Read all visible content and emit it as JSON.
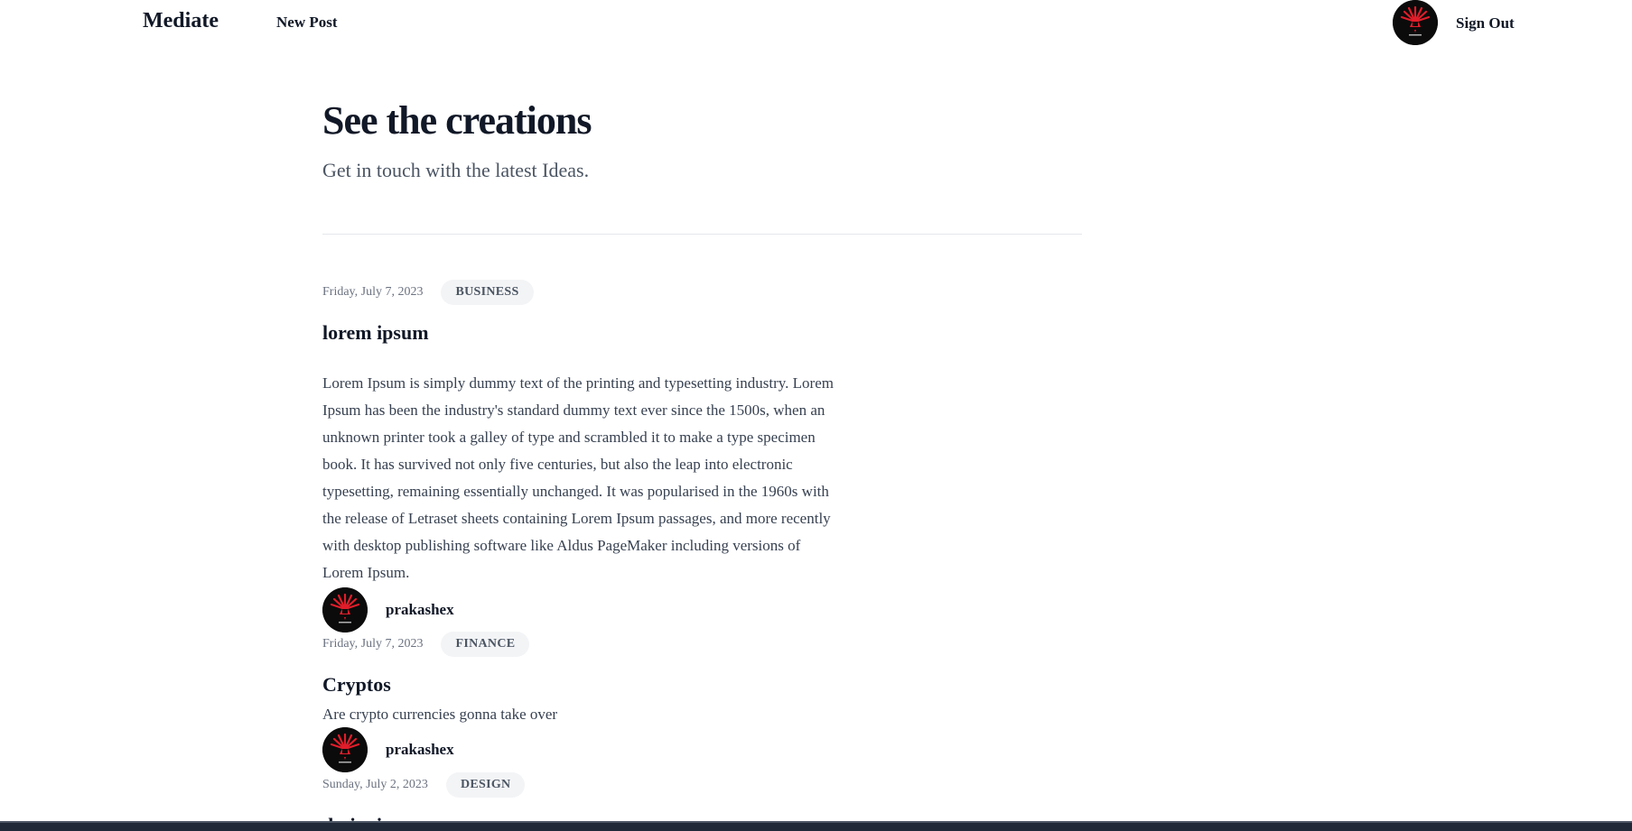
{
  "nav": {
    "brand": "Mediate",
    "new_post": "New Post",
    "sign_out": "Sign Out"
  },
  "hero": {
    "title": "See the creations",
    "subtitle": "Get in touch with the latest Ideas."
  },
  "posts": [
    {
      "date": "Friday, July 7, 2023",
      "category": "BUSINESS",
      "title": "lorem ipsum",
      "body": "Lorem Ipsum is simply dummy text of the printing and typesetting industry. Lorem Ipsum has been the industry's standard dummy text ever since the 1500s, when an unknown printer took a galley of type and scrambled it to make a type specimen book. It has survived not only five centuries, but also the leap into electronic typesetting, remaining essentially unchanged. It was popularised in the 1960s with the release of Letraset sheets containing Lorem Ipsum passages, and more recently with desktop publishing software like Aldus PageMaker including versions of Lorem Ipsum.",
      "author": "prakashex"
    },
    {
      "date": "Friday, July 7, 2023",
      "category": "FINANCE",
      "title": "Cryptos",
      "body": "Are crypto currencies gonna take over",
      "author": "prakashex"
    },
    {
      "date": "Sunday, July 2, 2023",
      "category": "DESIGN",
      "title": "designing",
      "body": "",
      "author": ""
    }
  ],
  "colors": {
    "text": "#111827",
    "muted": "#6b7280",
    "tag_bg": "#f3f4f6",
    "avatar_bg": "#0b0b0b",
    "avatar_accent": "#e11d2a"
  },
  "icons": {
    "avatar": "profile-avatar-red-emblem"
  }
}
